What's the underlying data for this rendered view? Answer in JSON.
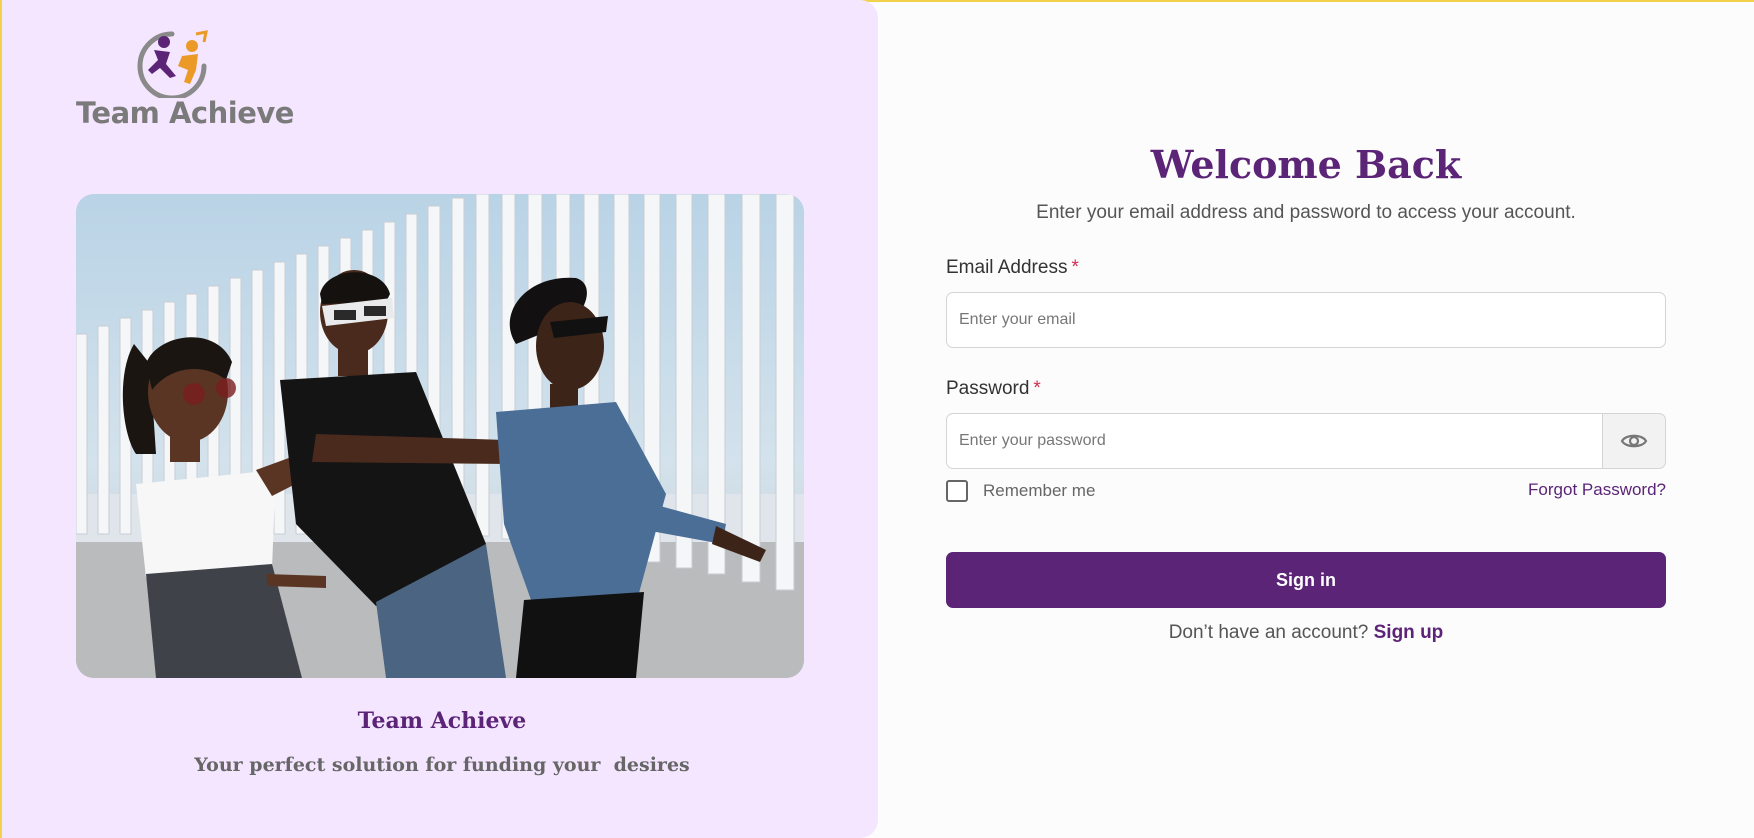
{
  "brand": {
    "logo_text": "Team Achieve",
    "logo_icon": "team-achieve-logo-icon",
    "title": "Team Achieve",
    "tagline": "Your perfect solution for funding your  desires"
  },
  "hero_image": {
    "subject": "hero-photo"
  },
  "login": {
    "heading": "Welcome Back",
    "subtitle": "Enter your email address and password to access your account.",
    "email_label": "Email Address",
    "email_required": "*",
    "email_value": "",
    "email_placeholder": "Enter your email",
    "password_label": "Password",
    "password_required": "*",
    "password_value": "",
    "password_placeholder": "Enter your password",
    "toggle_icon": "eye-icon",
    "remember_label": "Remember me",
    "remember_checked": false,
    "forgot_label": "Forgot Password?",
    "signin_label": "Sign in",
    "signup_prompt": "Don’t have an account?",
    "signup_label": "Sign up"
  },
  "colors": {
    "primary": "#5b2477",
    "left_panel_bg": "#f5e6ff",
    "right_bg": "#fcfcfc",
    "required": "#d0304f",
    "logo_orange": "#eb9a28",
    "logo_gray": "#7a7a7a"
  }
}
